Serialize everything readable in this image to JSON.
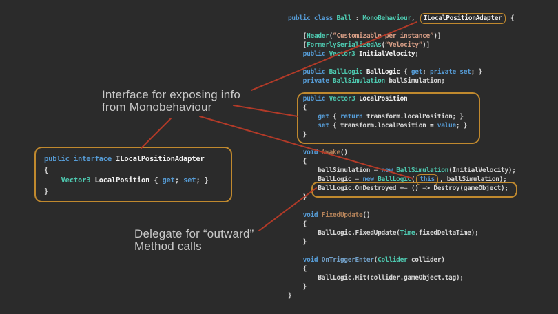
{
  "colors": {
    "background": "#2b2b2b",
    "highlight_box": "#c0892e",
    "arrow": "#b23a28",
    "keyword": "#569cd6",
    "type": "#4ec9b0",
    "string": "#d69d85",
    "plain": "#d6d6d6",
    "member": "#f0f0f0",
    "method": "#b5835a",
    "unity_method": "#72a0c8",
    "note_text": "#c8c8c8"
  },
  "annotations": {
    "interface_note": {
      "line1": "Interface for exposing info",
      "line2": "from Monobehaviour"
    },
    "delegate_note": {
      "line1": "Delegate for “outward”",
      "line2": "Method calls"
    }
  },
  "main_code": {
    "lines": [
      [
        [
          "k",
          "public class "
        ],
        [
          "t",
          "Ball "
        ],
        [
          "p",
          ": "
        ],
        [
          "t",
          "MonoBehaviour"
        ],
        [
          "p",
          ", "
        ],
        [
          "bx",
          "ILocalPositionAdapter"
        ],
        [
          "p",
          " {"
        ]
      ],
      [],
      [
        [
          "p",
          "    ["
        ],
        [
          "t",
          "Header"
        ],
        [
          "p",
          "("
        ],
        [
          "s",
          "“Customizable per instance”"
        ],
        [
          "p",
          ")]"
        ]
      ],
      [
        [
          "p",
          "    ["
        ],
        [
          "t",
          "FormerlySerializedAs"
        ],
        [
          "p",
          "("
        ],
        [
          "s",
          "“Velocity”"
        ],
        [
          "p",
          ")]"
        ]
      ],
      [
        [
          "k",
          "    public "
        ],
        [
          "t",
          "Vector3 "
        ],
        [
          "w",
          "InitialVelocity"
        ],
        [
          "p",
          ";"
        ]
      ],
      [],
      [
        [
          "k",
          "    public "
        ],
        [
          "t",
          "BallLogic "
        ],
        [
          "w",
          "BallLogic "
        ],
        [
          "p",
          "{ "
        ],
        [
          "k",
          "get"
        ],
        [
          "p",
          "; "
        ],
        [
          "k",
          "private set"
        ],
        [
          "p",
          "; }"
        ]
      ],
      [
        [
          "k",
          "    private "
        ],
        [
          "t",
          "BallSimulation "
        ],
        [
          "p",
          "ballSimulation;"
        ]
      ],
      [],
      [
        [
          "k",
          "    public "
        ],
        [
          "t",
          "Vector3 "
        ],
        [
          "w",
          "LocalPosition"
        ]
      ],
      [
        [
          "p",
          "    {"
        ]
      ],
      [
        [
          "p",
          "        "
        ],
        [
          "k",
          "get"
        ],
        [
          "p",
          " { "
        ],
        [
          "k",
          "return"
        ],
        [
          "p",
          " transform.localPosition; }"
        ]
      ],
      [
        [
          "p",
          "        "
        ],
        [
          "k",
          "set"
        ],
        [
          "p",
          " { transform.localPosition = "
        ],
        [
          "k",
          "value"
        ],
        [
          "p",
          "; }"
        ]
      ],
      [
        [
          "p",
          "    }"
        ]
      ],
      [],
      [
        [
          "k",
          "    void "
        ],
        [
          "m",
          "Awake"
        ],
        [
          "p",
          "()"
        ]
      ],
      [
        [
          "p",
          "    {"
        ]
      ],
      [
        [
          "p",
          "        ballSimulation = "
        ],
        [
          "k",
          "new "
        ],
        [
          "t",
          "BallSimulation"
        ],
        [
          "p",
          "(InitialVelocity);"
        ]
      ],
      [
        [
          "p",
          "        BallLogic = "
        ],
        [
          "k",
          "new "
        ],
        [
          "t",
          "BallLogic"
        ],
        [
          "p",
          "("
        ],
        [
          "bk",
          "this"
        ],
        [
          "p",
          ", ballSimulation);"
        ]
      ],
      [
        [
          "p",
          "        BallLogic.OnDestroyed += () => Destroy(gameObject);"
        ]
      ],
      [
        [
          "p",
          "    }"
        ]
      ],
      [],
      [
        [
          "k",
          "    void "
        ],
        [
          "m",
          "FixedUpdate"
        ],
        [
          "p",
          "()"
        ]
      ],
      [
        [
          "p",
          "    {"
        ]
      ],
      [
        [
          "p",
          "        BallLogic.FixedUpdate("
        ],
        [
          "t",
          "Time"
        ],
        [
          "p",
          ".fixedDeltaTime);"
        ]
      ],
      [
        [
          "p",
          "    }"
        ]
      ],
      [],
      [
        [
          "k",
          "    void "
        ],
        [
          "u",
          "OnTriggerEnter"
        ],
        [
          "p",
          "("
        ],
        [
          "t",
          "Collider"
        ],
        [
          "p",
          " collider)"
        ]
      ],
      [
        [
          "p",
          "    {"
        ]
      ],
      [
        [
          "p",
          "        BallLogic.Hit(collider.gameObject.tag);"
        ]
      ],
      [
        [
          "p",
          "    }"
        ]
      ],
      [
        [
          "p",
          "}"
        ]
      ]
    ]
  },
  "interface_code": {
    "lines": [
      [
        [
          "k",
          "public interface "
        ],
        [
          "w",
          "ILocalPositionAdapter"
        ]
      ],
      [
        [
          "p",
          "{"
        ]
      ],
      [
        [
          "p",
          "    "
        ],
        [
          "t",
          "Vector3 "
        ],
        [
          "w",
          "LocalPosition "
        ],
        [
          "p",
          "{ "
        ],
        [
          "k",
          "get"
        ],
        [
          "p",
          "; "
        ],
        [
          "k",
          "set"
        ],
        [
          "p",
          "; }"
        ]
      ],
      [
        [
          "p",
          "}"
        ]
      ]
    ]
  }
}
